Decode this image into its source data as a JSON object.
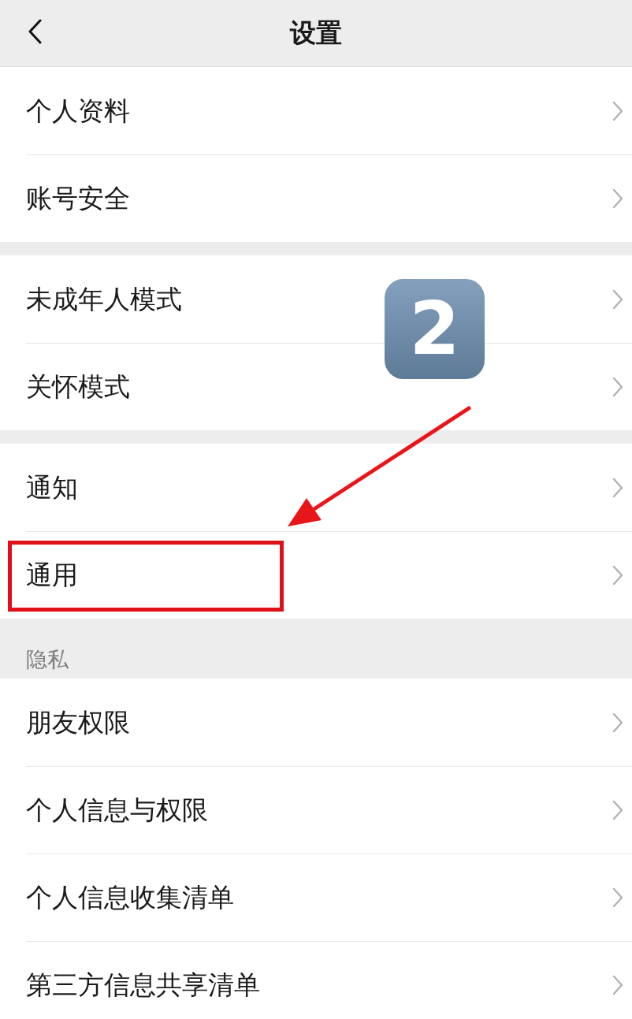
{
  "header": {
    "title": "设置"
  },
  "groups": [
    {
      "items": [
        {
          "label": "个人资料",
          "highlighted": false
        },
        {
          "label": "账号安全",
          "highlighted": false
        }
      ]
    },
    {
      "items": [
        {
          "label": "未成年人模式",
          "highlighted": false
        },
        {
          "label": "关怀模式",
          "highlighted": false
        }
      ]
    },
    {
      "items": [
        {
          "label": "通知",
          "highlighted": false
        },
        {
          "label": "通用",
          "highlighted": true
        }
      ]
    },
    {
      "title": "隐私",
      "items": [
        {
          "label": "朋友权限",
          "highlighted": false
        },
        {
          "label": "个人信息与权限",
          "highlighted": false
        },
        {
          "label": "个人信息收集清单",
          "highlighted": false
        },
        {
          "label": "第三方信息共享清单",
          "highlighted": false
        }
      ]
    }
  ],
  "annotation": {
    "step_badge": "2"
  }
}
